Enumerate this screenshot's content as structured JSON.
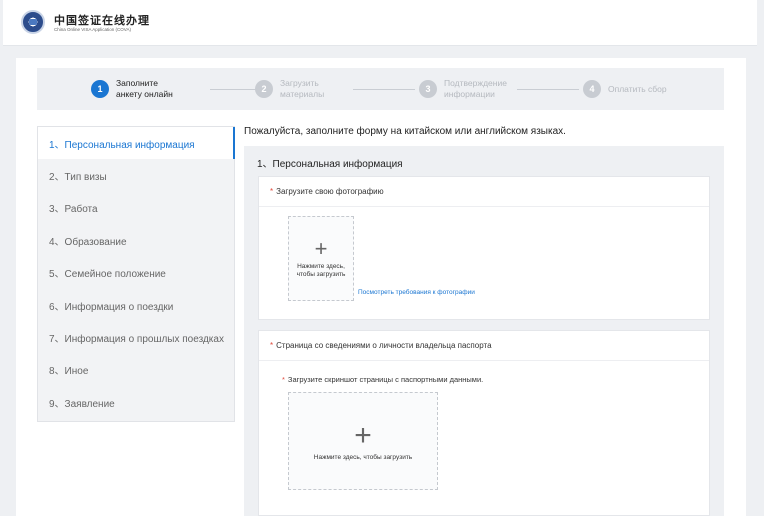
{
  "header": {
    "title": "中国签证在线办理",
    "subtitle": "China Online VISA Application  (COVA)"
  },
  "steps": [
    {
      "number": "1",
      "label": "Заполните\nанкету онлайн"
    },
    {
      "number": "2",
      "label": "Загрузить\nматериалы"
    },
    {
      "number": "3",
      "label": "Подтверждение\nинформации"
    },
    {
      "number": "4",
      "label": "Оплатить сбор"
    }
  ],
  "sidebar": {
    "items": [
      {
        "label": "1、Персональная информация"
      },
      {
        "label": "2、Тип визы"
      },
      {
        "label": "3、Работа"
      },
      {
        "label": "4、Образование"
      },
      {
        "label": "5、Семейное положение"
      },
      {
        "label": "6、Информация о поездки"
      },
      {
        "label": "7、Информация о прошлых поездках"
      },
      {
        "label": "8、Иное"
      },
      {
        "label": "9、Заявление"
      }
    ]
  },
  "main": {
    "intro": "Пожалуйста, заполните форму на китайском или английском языках.",
    "section_title": "1、Персональная информация",
    "required_mark": "*",
    "photo": {
      "title": "Загрузите свою фотографию",
      "upload_text": "Нажмите здесь, чтобы загрузить",
      "requirements_link": "Посмотреть требования к фотографии"
    },
    "passport": {
      "title": "Страница со сведениями о личности владельца паспорта",
      "subtitle": "Загрузите скриншот страницы с паспортными данными.",
      "upload_text": "Нажмите здесь, чтобы загрузить"
    }
  },
  "colors": {
    "accent": "#1a76d2",
    "required": "#e04a3c",
    "inactive_step": "#c8ccd2"
  },
  "icons": {
    "logo": "emblem-logo",
    "upload": "plus-icon"
  }
}
